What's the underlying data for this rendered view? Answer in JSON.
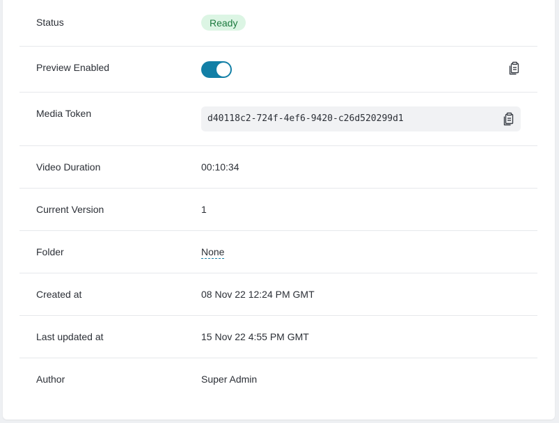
{
  "details": {
    "status": {
      "label": "Status",
      "value": "Ready"
    },
    "preview": {
      "label": "Preview Enabled",
      "enabled": true
    },
    "token": {
      "label": "Media Token",
      "value": "d40118c2-724f-4ef6-9420-c26d520299d1"
    },
    "duration": {
      "label": "Video Duration",
      "value": "00:10:34"
    },
    "version": {
      "label": "Current Version",
      "value": "1"
    },
    "folder": {
      "label": "Folder",
      "value": "None"
    },
    "created": {
      "label": "Created at",
      "value": "08 Nov 22 12:24 PM GMT"
    },
    "updated": {
      "label": "Last updated at",
      "value": "15 Nov 22 4:55 PM GMT"
    },
    "author": {
      "label": "Author",
      "value": "Super Admin"
    }
  },
  "colors": {
    "accent": "#127fa6",
    "status_ready_bg": "#dcf5e4",
    "status_ready_text": "#1b7a3e"
  },
  "icons": {
    "copy": "clipboard-copy-icon"
  }
}
